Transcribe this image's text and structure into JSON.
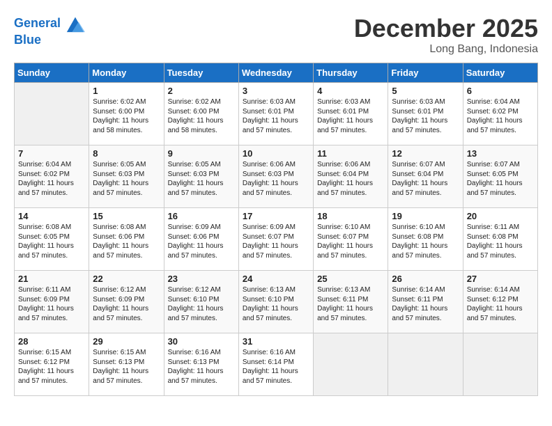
{
  "header": {
    "logo_line1": "General",
    "logo_line2": "Blue",
    "month": "December 2025",
    "location": "Long Bang, Indonesia"
  },
  "days_of_week": [
    "Sunday",
    "Monday",
    "Tuesday",
    "Wednesday",
    "Thursday",
    "Friday",
    "Saturday"
  ],
  "weeks": [
    [
      {
        "day": "",
        "empty": true
      },
      {
        "day": "1",
        "sunrise": "Sunrise: 6:02 AM",
        "sunset": "Sunset: 6:00 PM",
        "daylight": "Daylight: 11 hours and 58 minutes."
      },
      {
        "day": "2",
        "sunrise": "Sunrise: 6:02 AM",
        "sunset": "Sunset: 6:00 PM",
        "daylight": "Daylight: 11 hours and 58 minutes."
      },
      {
        "day": "3",
        "sunrise": "Sunrise: 6:03 AM",
        "sunset": "Sunset: 6:01 PM",
        "daylight": "Daylight: 11 hours and 57 minutes."
      },
      {
        "day": "4",
        "sunrise": "Sunrise: 6:03 AM",
        "sunset": "Sunset: 6:01 PM",
        "daylight": "Daylight: 11 hours and 57 minutes."
      },
      {
        "day": "5",
        "sunrise": "Sunrise: 6:03 AM",
        "sunset": "Sunset: 6:01 PM",
        "daylight": "Daylight: 11 hours and 57 minutes."
      },
      {
        "day": "6",
        "sunrise": "Sunrise: 6:04 AM",
        "sunset": "Sunset: 6:02 PM",
        "daylight": "Daylight: 11 hours and 57 minutes."
      }
    ],
    [
      {
        "day": "7",
        "sunrise": "Sunrise: 6:04 AM",
        "sunset": "Sunset: 6:02 PM",
        "daylight": "Daylight: 11 hours and 57 minutes."
      },
      {
        "day": "8",
        "sunrise": "Sunrise: 6:05 AM",
        "sunset": "Sunset: 6:03 PM",
        "daylight": "Daylight: 11 hours and 57 minutes."
      },
      {
        "day": "9",
        "sunrise": "Sunrise: 6:05 AM",
        "sunset": "Sunset: 6:03 PM",
        "daylight": "Daylight: 11 hours and 57 minutes."
      },
      {
        "day": "10",
        "sunrise": "Sunrise: 6:06 AM",
        "sunset": "Sunset: 6:03 PM",
        "daylight": "Daylight: 11 hours and 57 minutes."
      },
      {
        "day": "11",
        "sunrise": "Sunrise: 6:06 AM",
        "sunset": "Sunset: 6:04 PM",
        "daylight": "Daylight: 11 hours and 57 minutes."
      },
      {
        "day": "12",
        "sunrise": "Sunrise: 6:07 AM",
        "sunset": "Sunset: 6:04 PM",
        "daylight": "Daylight: 11 hours and 57 minutes."
      },
      {
        "day": "13",
        "sunrise": "Sunrise: 6:07 AM",
        "sunset": "Sunset: 6:05 PM",
        "daylight": "Daylight: 11 hours and 57 minutes."
      }
    ],
    [
      {
        "day": "14",
        "sunrise": "Sunrise: 6:08 AM",
        "sunset": "Sunset: 6:05 PM",
        "daylight": "Daylight: 11 hours and 57 minutes."
      },
      {
        "day": "15",
        "sunrise": "Sunrise: 6:08 AM",
        "sunset": "Sunset: 6:06 PM",
        "daylight": "Daylight: 11 hours and 57 minutes."
      },
      {
        "day": "16",
        "sunrise": "Sunrise: 6:09 AM",
        "sunset": "Sunset: 6:06 PM",
        "daylight": "Daylight: 11 hours and 57 minutes."
      },
      {
        "day": "17",
        "sunrise": "Sunrise: 6:09 AM",
        "sunset": "Sunset: 6:07 PM",
        "daylight": "Daylight: 11 hours and 57 minutes."
      },
      {
        "day": "18",
        "sunrise": "Sunrise: 6:10 AM",
        "sunset": "Sunset: 6:07 PM",
        "daylight": "Daylight: 11 hours and 57 minutes."
      },
      {
        "day": "19",
        "sunrise": "Sunrise: 6:10 AM",
        "sunset": "Sunset: 6:08 PM",
        "daylight": "Daylight: 11 hours and 57 minutes."
      },
      {
        "day": "20",
        "sunrise": "Sunrise: 6:11 AM",
        "sunset": "Sunset: 6:08 PM",
        "daylight": "Daylight: 11 hours and 57 minutes."
      }
    ],
    [
      {
        "day": "21",
        "sunrise": "Sunrise: 6:11 AM",
        "sunset": "Sunset: 6:09 PM",
        "daylight": "Daylight: 11 hours and 57 minutes."
      },
      {
        "day": "22",
        "sunrise": "Sunrise: 6:12 AM",
        "sunset": "Sunset: 6:09 PM",
        "daylight": "Daylight: 11 hours and 57 minutes."
      },
      {
        "day": "23",
        "sunrise": "Sunrise: 6:12 AM",
        "sunset": "Sunset: 6:10 PM",
        "daylight": "Daylight: 11 hours and 57 minutes."
      },
      {
        "day": "24",
        "sunrise": "Sunrise: 6:13 AM",
        "sunset": "Sunset: 6:10 PM",
        "daylight": "Daylight: 11 hours and 57 minutes."
      },
      {
        "day": "25",
        "sunrise": "Sunrise: 6:13 AM",
        "sunset": "Sunset: 6:11 PM",
        "daylight": "Daylight: 11 hours and 57 minutes."
      },
      {
        "day": "26",
        "sunrise": "Sunrise: 6:14 AM",
        "sunset": "Sunset: 6:11 PM",
        "daylight": "Daylight: 11 hours and 57 minutes."
      },
      {
        "day": "27",
        "sunrise": "Sunrise: 6:14 AM",
        "sunset": "Sunset: 6:12 PM",
        "daylight": "Daylight: 11 hours and 57 minutes."
      }
    ],
    [
      {
        "day": "28",
        "sunrise": "Sunrise: 6:15 AM",
        "sunset": "Sunset: 6:12 PM",
        "daylight": "Daylight: 11 hours and 57 minutes."
      },
      {
        "day": "29",
        "sunrise": "Sunrise: 6:15 AM",
        "sunset": "Sunset: 6:13 PM",
        "daylight": "Daylight: 11 hours and 57 minutes."
      },
      {
        "day": "30",
        "sunrise": "Sunrise: 6:16 AM",
        "sunset": "Sunset: 6:13 PM",
        "daylight": "Daylight: 11 hours and 57 minutes."
      },
      {
        "day": "31",
        "sunrise": "Sunrise: 6:16 AM",
        "sunset": "Sunset: 6:14 PM",
        "daylight": "Daylight: 11 hours and 57 minutes."
      },
      {
        "day": "",
        "empty": true
      },
      {
        "day": "",
        "empty": true
      },
      {
        "day": "",
        "empty": true
      }
    ]
  ]
}
